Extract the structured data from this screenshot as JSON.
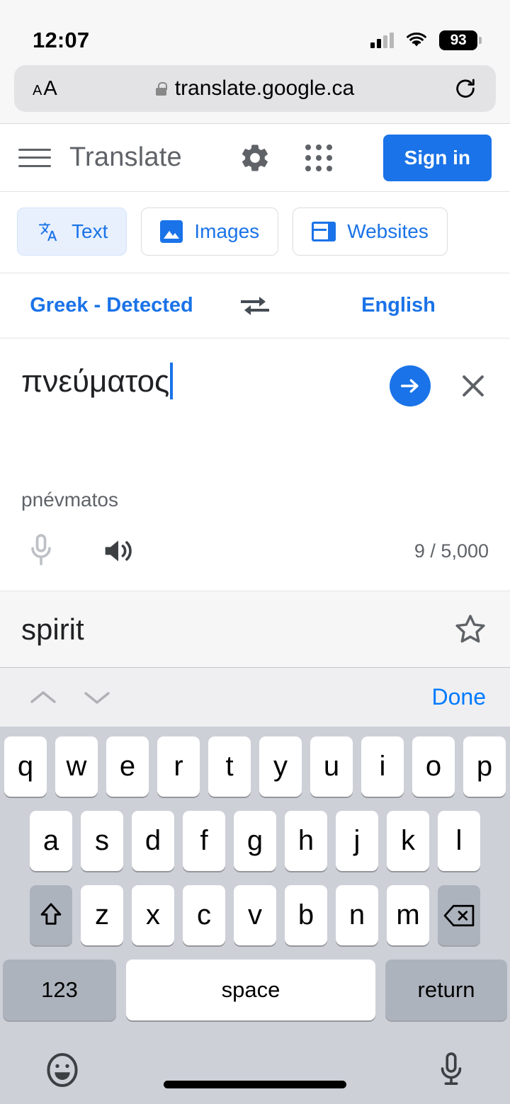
{
  "status_bar": {
    "time": "12:07",
    "cellular_icon": "cellular-signal-icon",
    "wifi_icon": "wifi-icon",
    "battery_level": "93"
  },
  "browser": {
    "text_size_small": "A",
    "text_size_large": "A",
    "lock_icon": "lock-icon",
    "url": "translate.google.ca",
    "reload_icon": "reload-icon"
  },
  "app_header": {
    "menu_icon": "hamburger-menu-icon",
    "title": "Translate",
    "settings_icon": "gear-icon",
    "apps_icon": "apps-grid-icon",
    "sign_in_label": "Sign in",
    "accent_color": "#1a73e8"
  },
  "mode_tabs": [
    {
      "label": "Text",
      "icon": "translate-text-icon",
      "active": true
    },
    {
      "label": "Images",
      "icon": "image-icon",
      "active": false
    },
    {
      "label": "Websites",
      "icon": "website-icon",
      "active": false
    }
  ],
  "language_bar": {
    "source_language": "Greek - Detected",
    "swap_icon": "swap-languages-icon",
    "target_language": "English"
  },
  "source_panel": {
    "input_text": "πνεύματος",
    "transliteration": "pnévmatos",
    "submit_icon": "arrow-forward-icon",
    "clear_icon": "close-icon",
    "mic_icon": "microphone-icon",
    "speaker_icon": "speaker-icon",
    "char_counter": "9 / 5,000"
  },
  "result_panel": {
    "translation": "spirit",
    "star_icon": "star-outline-icon"
  },
  "keyboard_accessory": {
    "prev_icon": "chevron-up-icon",
    "next_icon": "chevron-down-icon",
    "done_label": "Done"
  },
  "keyboard": {
    "row1": [
      "q",
      "w",
      "e",
      "r",
      "t",
      "y",
      "u",
      "i",
      "o",
      "p"
    ],
    "row2": [
      "a",
      "s",
      "d",
      "f",
      "g",
      "h",
      "j",
      "k",
      "l"
    ],
    "row3": [
      "z",
      "x",
      "c",
      "v",
      "b",
      "n",
      "m"
    ],
    "shift_icon": "shift-icon",
    "backspace_icon": "backspace-icon",
    "numbers_label": "123",
    "space_label": "space",
    "return_label": "return",
    "emoji_icon": "emoji-icon",
    "dictation_icon": "dictation-microphone-icon"
  }
}
